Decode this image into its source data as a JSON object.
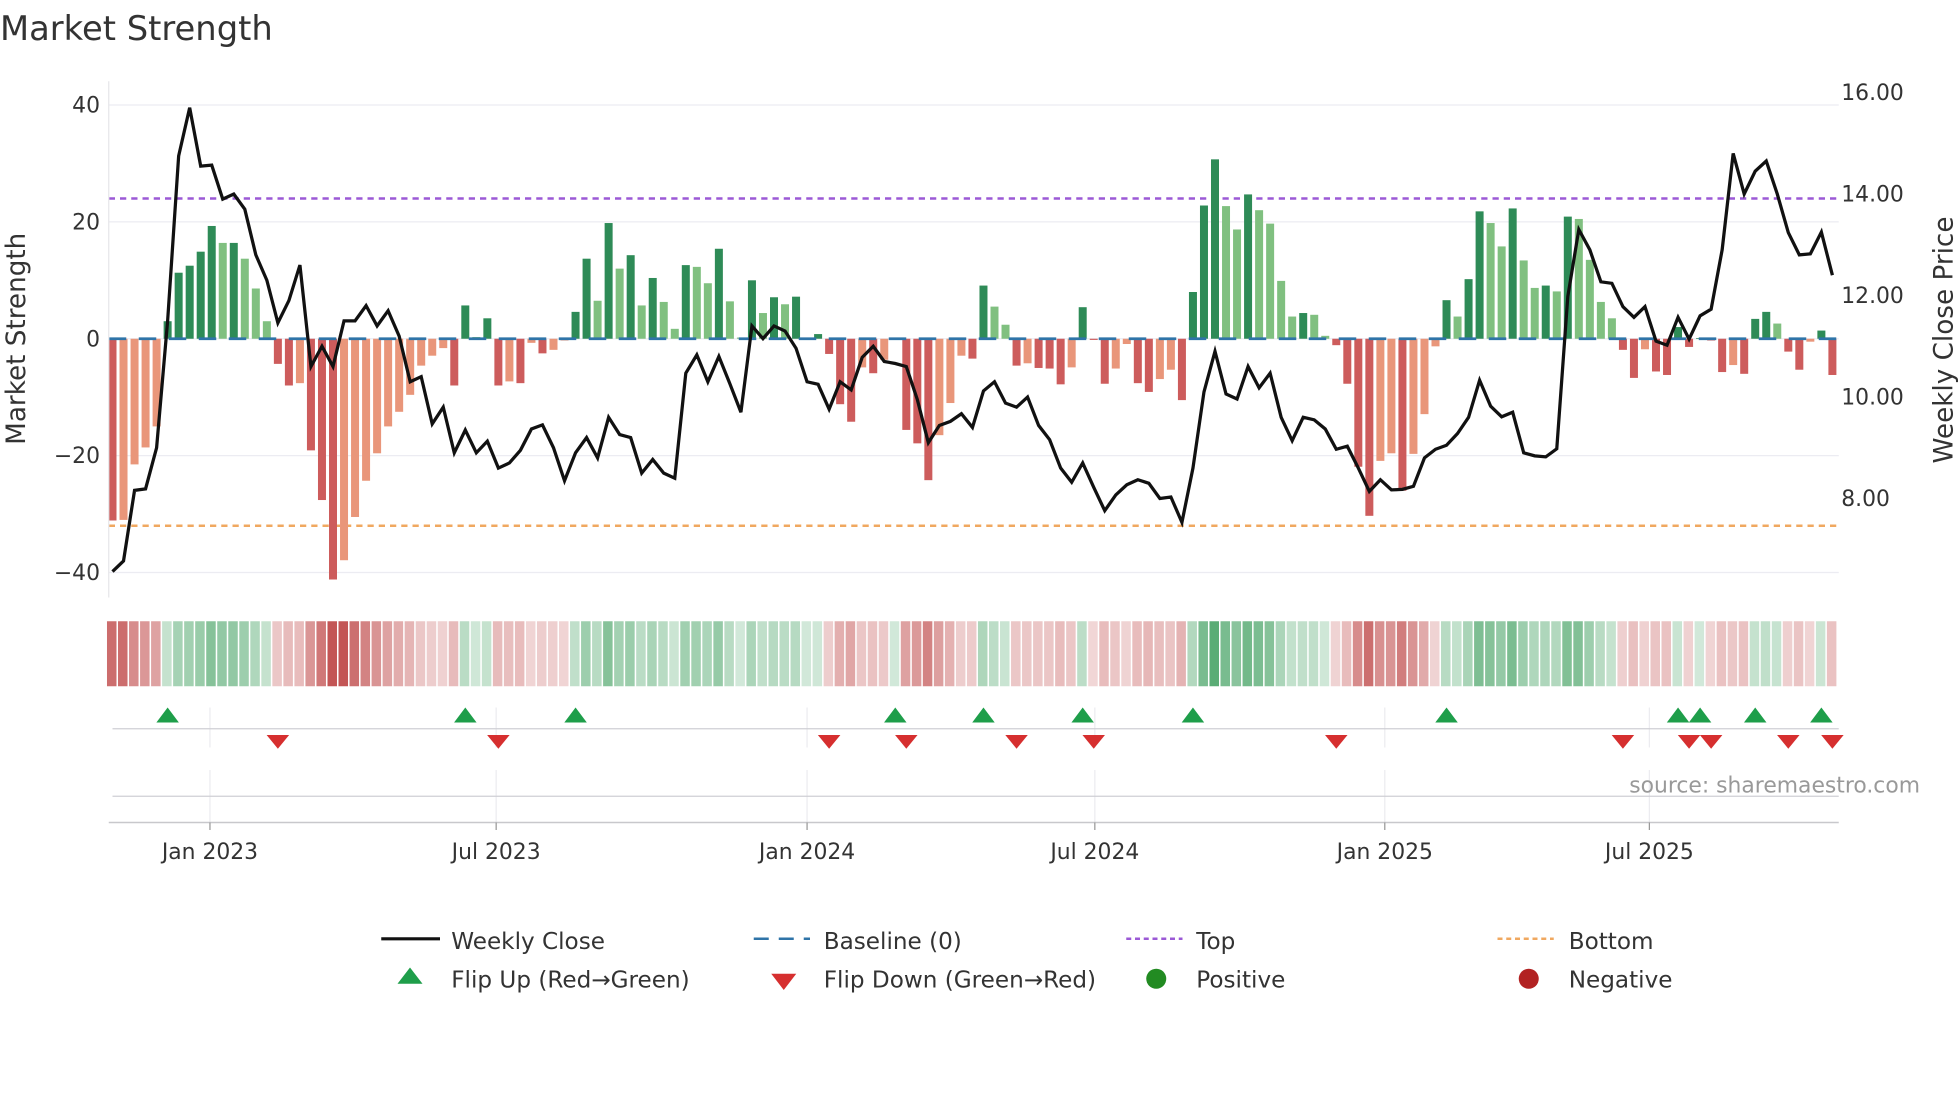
{
  "title": "Market Strength",
  "source": "source: sharemaestro.com",
  "legend": {
    "weekly_close": "Weekly Close",
    "baseline": "Baseline (0)",
    "top": "Top",
    "bottom": "Bottom",
    "flip_up": "Flip Up (Red→Green)",
    "flip_down": "Flip Down (Green→Red)",
    "positive": "Positive",
    "negative": "Negative"
  },
  "colors": {
    "pos_rising": "#2e8b57",
    "pos_falling": "#80c080",
    "neg_falling": "#cd5c5c",
    "neg_rising": "#e9967a",
    "line": "#111111",
    "baseline": "#2f74a8",
    "top": "#9b59d6",
    "bottom": "#f0a860",
    "flip_up": "#1e9e4a",
    "flip_down": "#d62f2f",
    "positive": "#228b22",
    "negative": "#b22222"
  },
  "chart_data": {
    "type": "bar",
    "title": "Market Strength",
    "ylabel": "Market Strength",
    "y2label": "Weekly Close Price",
    "ylim": [
      -44,
      42
    ],
    "y2lim": [
      6.2,
      16.3
    ],
    "yticks": [
      40,
      20,
      0,
      -20,
      -40
    ],
    "yticklabels": [
      "40",
      "20",
      "0",
      "−20",
      "−40"
    ],
    "y2ticks": [
      16,
      14,
      12,
      10,
      8
    ],
    "y2ticklabels": [
      "16.00",
      "14.00",
      "12.00",
      "10.00",
      "8.00"
    ],
    "x_unit": "week index",
    "xticks": [
      8.84,
      34.8,
      63.0,
      89.1,
      115.4,
      139.4
    ],
    "xticklabels": [
      "Jan 2023",
      "Jul 2023",
      "Jan 2024",
      "Jul 2024",
      "Jan 2025",
      "Jul 2025"
    ],
    "top_level": 24,
    "bottom_level": -32,
    "baseline": 0,
    "strength": [
      -31.1,
      -31,
      -21.5,
      -18.6,
      -15,
      3,
      11.3,
      12.5,
      14.9,
      19.3,
      16.4,
      16.4,
      13.7,
      8.6,
      3,
      -4.3,
      -8,
      -7.6,
      -19.1,
      -27.6,
      -41.2,
      -37.9,
      -30.5,
      -24.3,
      -19.6,
      -15,
      -12.5,
      -9.6,
      -4.6,
      -2.9,
      -1.6,
      -8,
      5.7,
      0.3,
      3.5,
      -8,
      -7.3,
      -7.6,
      -0.7,
      -2.5,
      -1.9,
      -0.3,
      4.6,
      13.7,
      6.5,
      19.8,
      12,
      14.3,
      5.7,
      10.4,
      6.3,
      1.7,
      12.6,
      12.3,
      9.5,
      15.4,
      6.4,
      0.2,
      10,
      4.4,
      7.1,
      5.9,
      7.2,
      0.1,
      0.8,
      -2.6,
      -11.2,
      -14.2,
      -4.9,
      -5.9,
      -3.6,
      0.2,
      -15.6,
      -17.9,
      -24.2,
      -16.5,
      -11,
      -2.9,
      -3.4,
      9.1,
      5.5,
      2.4,
      -4.6,
      -4.2,
      -5,
      -5.1,
      -7.8,
      -4.9,
      5.4,
      -0.2,
      -7.7,
      -5.1,
      -0.9,
      -7.6,
      -9.1,
      -6.9,
      -5.3,
      -10.5,
      8,
      22.8,
      30.7,
      22.7,
      18.7,
      24.7,
      22,
      19.7,
      9.9,
      3.8,
      4.4,
      4.1,
      0.5,
      -1.1,
      -7.7,
      -21.9,
      -30.3,
      -20.9,
      -19.6,
      -26,
      -19.7,
      -12.9,
      -1.3,
      6.6,
      3.8,
      10.2,
      21.8,
      19.8,
      15.8,
      22.3,
      13.4,
      8.7,
      9.1,
      8.1,
      20.9,
      20.5,
      13.5,
      6.3,
      3.5,
      -1.9,
      -6.7,
      -1.8,
      -5.6,
      -6.2,
      2,
      -1.4,
      0.1,
      -0.3,
      -5.7,
      -4.5,
      -6,
      3.4,
      4.6,
      2.6,
      -2.2,
      -5.3,
      -0.5,
      1.4,
      -6.2
    ],
    "weekly_close": [
      6.56,
      6.77,
      8.16,
      8.19,
      9.0,
      11.5,
      14.75,
      15.7,
      14.55,
      14.57,
      13.9,
      14.0,
      13.7,
      12.8,
      12.3,
      11.46,
      11.9,
      12.6,
      10.6,
      11.0,
      10.6,
      11.5,
      11.5,
      11.8,
      11.4,
      11.7,
      11.2,
      10.3,
      10.4,
      9.47,
      9.8,
      8.9,
      9.35,
      8.9,
      9.13,
      8.6,
      8.7,
      8.95,
      9.37,
      9.45,
      9.0,
      8.35,
      8.9,
      9.2,
      8.8,
      9.6,
      9.26,
      9.2,
      8.5,
      8.77,
      8.5,
      8.4,
      10.47,
      10.83,
      10.3,
      10.8,
      10.26,
      9.7,
      11.4,
      11.15,
      11.4,
      11.3,
      10.96,
      10.3,
      10.25,
      9.76,
      10.3,
      10.14,
      10.78,
      11.0,
      10.7,
      10.66,
      10.6,
      9.95,
      9.1,
      9.44,
      9.52,
      9.67,
      9.4,
      10.12,
      10.3,
      9.88,
      9.8,
      10.0,
      9.44,
      9.16,
      8.6,
      8.32,
      8.7,
      8.22,
      7.76,
      8.07,
      8.27,
      8.37,
      8.3,
      8.0,
      8.03,
      7.53,
      8.6,
      10.1,
      10.9,
      10.06,
      9.96,
      10.6,
      10.18,
      10.47,
      9.6,
      9.14,
      9.6,
      9.55,
      9.37,
      8.97,
      9.03,
      8.6,
      8.14,
      8.37,
      8.17,
      8.18,
      8.24,
      8.8,
      8.97,
      9.05,
      9.28,
      9.6,
      10.33,
      9.82,
      9.61,
      9.7,
      8.9,
      8.84,
      8.82,
      8.98,
      11.98,
      13.3,
      12.9,
      12.27,
      12.24,
      11.78,
      11.57,
      11.78,
      11.1,
      11.02,
      11.57,
      11.14,
      11.6,
      11.73,
      12.9,
      14.8,
      14.0,
      14.45,
      14.65,
      14.0,
      13.24,
      12.8,
      12.82,
      13.25,
      12.4
    ],
    "flip_up_weeks": [
      5,
      32,
      42,
      71,
      79,
      88,
      98,
      121,
      142,
      144,
      149,
      155
    ],
    "flip_down_weeks": [
      15,
      35,
      65,
      72,
      82,
      89,
      111,
      137,
      143,
      145,
      152,
      156
    ],
    "legend_position": "bottom"
  }
}
